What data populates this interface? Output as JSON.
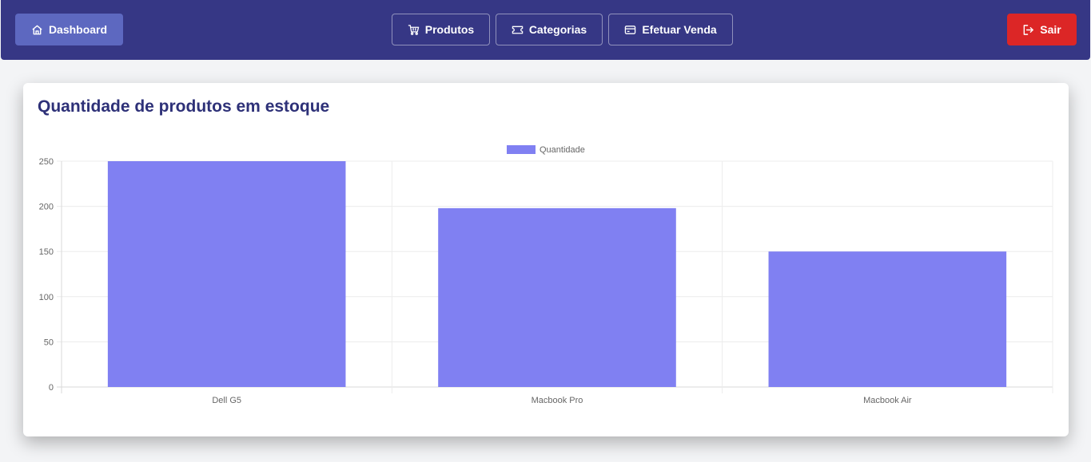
{
  "navbar": {
    "dashboard_label": "Dashboard",
    "produtos_label": "Produtos",
    "categorias_label": "Categorias",
    "efetuar_venda_label": "Efetuar Venda",
    "sair_label": "Sair",
    "icons": {
      "dashboard": "home-icon",
      "produtos": "cart-icon",
      "categorias": "ticket-icon",
      "efetuar_venda": "credit-card-icon",
      "sair": "logout-icon"
    },
    "colors": {
      "background": "#363785",
      "dashboard_button": "#5d68c0",
      "sair_button": "#dc2626"
    }
  },
  "card": {
    "title": "Quantidade de produtos em estoque"
  },
  "chart_data": {
    "type": "bar",
    "categories": [
      "Dell G5",
      "Macbook Pro",
      "Macbook Air"
    ],
    "series": [
      {
        "name": "Quantidade",
        "values": [
          250,
          198,
          150
        ],
        "color": "#8080f2"
      }
    ],
    "ylim": [
      0,
      250
    ],
    "yticks": [
      0,
      50,
      100,
      150,
      200,
      250
    ],
    "grid": true,
    "legend": "top-center",
    "xlabel": "",
    "ylabel": ""
  }
}
